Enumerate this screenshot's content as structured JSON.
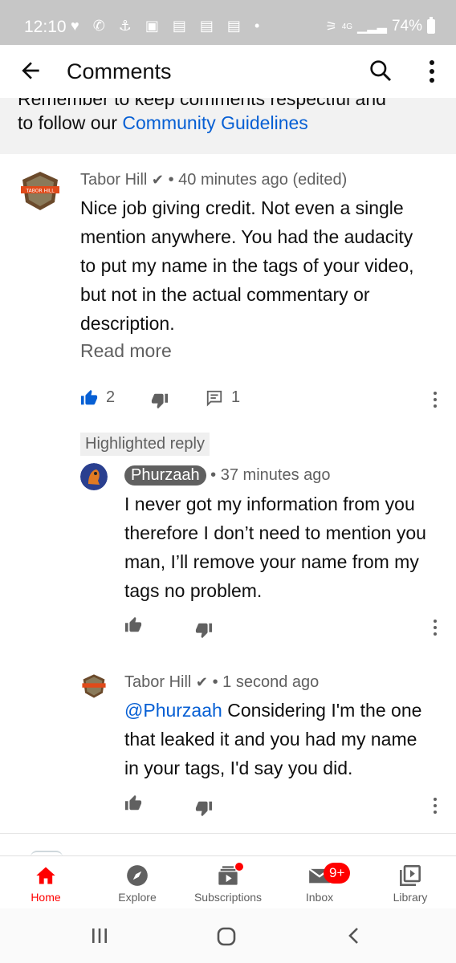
{
  "status_bar": {
    "time": "12:10",
    "network": "4G",
    "battery": "74%"
  },
  "header": {
    "title": "Comments"
  },
  "guidelines": {
    "cut_text": "Remember to keep comments respectful and",
    "prefix": "to follow our ",
    "link": "Community Guidelines"
  },
  "comments": [
    {
      "author": "Tabor Hill",
      "verified": true,
      "time": "40 minutes ago (edited)",
      "text": "Nice job giving credit.  Not even a single mention anywhere.  You had the audacity to put my name in the tags of your video, but not in the actual commentary or description.",
      "read_more": "Read more",
      "likes": "2",
      "replies": "1"
    }
  ],
  "highlighted_label": "Highlighted reply",
  "replies": [
    {
      "author": "Phurzaah",
      "time": "37 minutes ago",
      "text": "I never got my information from you therefore I don’t need to mention you man, I’ll remove your name from my tags no problem."
    },
    {
      "author": "Tabor Hill",
      "verified": true,
      "time": "1 second ago",
      "mention": "@Phurzaah",
      "text": " Considering I'm the one that leaked it and you had my name in your tags, I'd say you did."
    }
  ],
  "bottom_nav": [
    {
      "label": "Home",
      "icon": "home-icon",
      "active": true
    },
    {
      "label": "Explore",
      "icon": "compass-icon"
    },
    {
      "label": "Subscriptions",
      "icon": "subscriptions-icon"
    },
    {
      "label": "Inbox",
      "icon": "mail-icon",
      "badge": "9+"
    },
    {
      "label": "Library",
      "icon": "library-icon"
    }
  ],
  "colors": {
    "accent_red": "#ff0000",
    "link_blue": "#065fd4",
    "like_active": "#065fd4",
    "text_secondary": "#606060"
  }
}
